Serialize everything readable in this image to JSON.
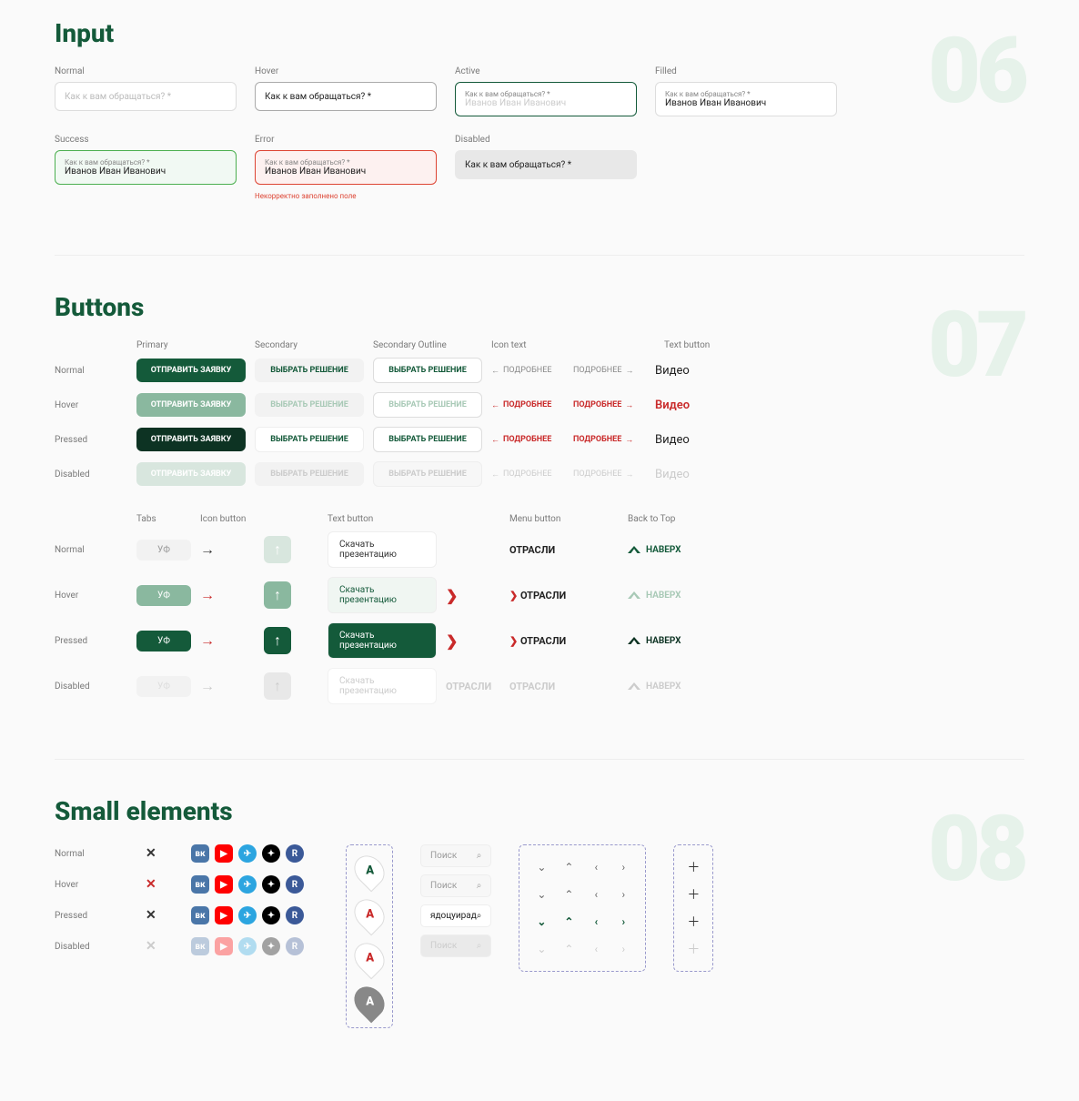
{
  "sections": {
    "input": {
      "title": "Input",
      "num": "06"
    },
    "buttons": {
      "title": "Buttons",
      "num": "07"
    },
    "small": {
      "title": "Small elements",
      "num": "08"
    }
  },
  "input_states": {
    "normal": {
      "label": "Normal",
      "placeholder": "Как к вам обращаться? *"
    },
    "hover": {
      "label": "Hover",
      "placeholder": "Как к вам обращаться? *"
    },
    "active": {
      "label": "Active",
      "floating": "Как к вам обращаться? *",
      "value": "Иванов Иван Иванович"
    },
    "filled": {
      "label": "Filled",
      "floating": "Как к вам обращаться? *",
      "value": "Иванов Иван Иванович"
    },
    "success": {
      "label": "Success",
      "floating": "Как к вам обращаться? *",
      "value": "Иванов Иван Иванович"
    },
    "error": {
      "label": "Error",
      "floating": "Как к вам обращаться? *",
      "value": "Иванов Иван Иванович",
      "msg": "Некорректно заполнено поле"
    },
    "disabled": {
      "label": "Disabled",
      "placeholder": "Как к вам обращаться? *"
    }
  },
  "btn_headers": {
    "primary": "Primary",
    "secondary": "Secondary",
    "outline": "Secondary Outline",
    "icon": "Icon text",
    "text": "Text button"
  },
  "btn_states": [
    "Normal",
    "Hover",
    "Pressed",
    "Disabled"
  ],
  "btn_labels": {
    "primary": "ОТПРАВИТЬ ЗАЯВКУ",
    "secondary": "ВЫБРАТЬ РЕШЕНИЕ",
    "icon": "ПОДРОБНЕЕ",
    "text": "Видео"
  },
  "btn_headers2": {
    "tabs": "Tabs",
    "iconbtn": "Icon button",
    "textbtn": "Text button",
    "menu": "Menu button",
    "back": "Back to Top"
  },
  "btn_labels2": {
    "tab": "УФ",
    "dl": "Скачать презентацию",
    "menu": "ОТРАСЛИ",
    "back": "НАВЕРХ"
  },
  "small": {
    "states": [
      "Normal",
      "Hover",
      "Pressed",
      "Disabled"
    ],
    "search_placeholder": "Поиск",
    "search_value": "ядоцуирад",
    "pin": "A"
  }
}
